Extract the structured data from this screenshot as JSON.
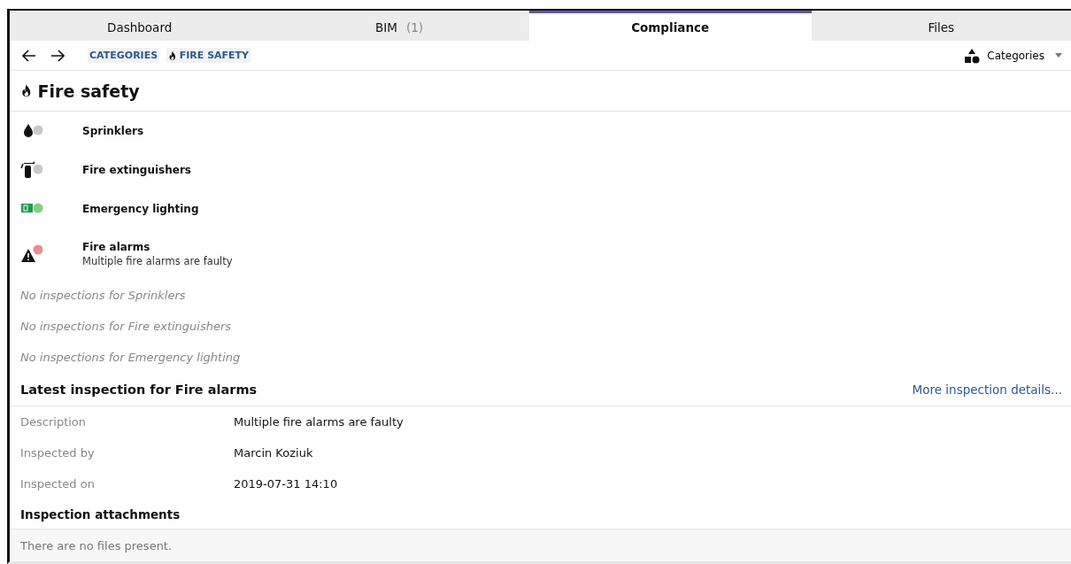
{
  "tabs": [
    {
      "label": "Dashboard",
      "selected": false
    },
    {
      "label": "BIM",
      "count": "(1)",
      "selected": false
    },
    {
      "label": "Compliance",
      "selected": true
    },
    {
      "label": "Files",
      "selected": false
    }
  ],
  "breadcrumbs": [
    {
      "label": "CATEGORIES",
      "kind": "plain"
    },
    {
      "label": "FIRE SAFETY",
      "kind": "flame"
    }
  ],
  "view_dropdown": {
    "label": "Categories"
  },
  "title": "Fire safety",
  "categories": [
    {
      "name": "Sprinklers",
      "kind": "sprinkler",
      "color": "#c8c8c8"
    },
    {
      "name": "Fire extinguishers",
      "kind": "extinguisher",
      "color": "#c8c8c8"
    },
    {
      "name": "Emergency lighting",
      "kind": "exit",
      "color": "#7fd37f"
    },
    {
      "name": "Fire alarms",
      "kind": "alarm",
      "color": "#e48f8f",
      "note": "Multiple fire alarms are faulty"
    }
  ],
  "no_inspections": [
    "No inspections for Sprinklers",
    "No inspections for Fire extinguishers",
    "No inspections for Emergency lighting"
  ],
  "latest": {
    "heading": "Latest inspection for Fire alarms",
    "link": "More inspection details...",
    "fields": [
      {
        "label": "Description",
        "value": "Multiple fire alarms are faulty"
      },
      {
        "label": "Inspected by",
        "value": "Marcin Koziuk"
      },
      {
        "label": "Inspected on",
        "value": "2019-07-31 14:10"
      }
    ],
    "attachments_heading": "Inspection attachments",
    "attachments_empty": "There are no files present."
  }
}
